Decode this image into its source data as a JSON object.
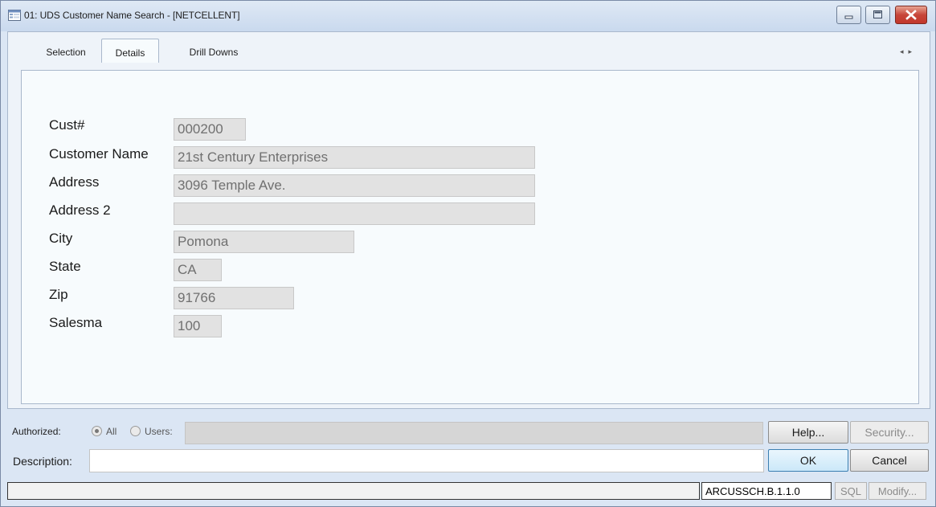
{
  "window": {
    "title": "01:  UDS Customer Name Search - [NETCELLENT]",
    "controls": {
      "minimize": "minimize-icon",
      "maximize": "maximize-icon",
      "close": "close-icon"
    }
  },
  "tabs": [
    {
      "label": "Selection",
      "active": false
    },
    {
      "label": "Details",
      "active": true
    },
    {
      "label": "Drill Downs",
      "active": false
    }
  ],
  "tab_scroll": {
    "left": "◂",
    "right": "▸"
  },
  "details": {
    "fields": [
      {
        "label": "Cust#",
        "value": "000200"
      },
      {
        "label": "Customer Name",
        "value": "21st Century Enterprises"
      },
      {
        "label": "Address",
        "value": "3096 Temple Ave."
      },
      {
        "label": "Address 2",
        "value": ""
      },
      {
        "label": "City",
        "value": "Pomona"
      },
      {
        "label": "State",
        "value": "CA"
      },
      {
        "label": "Zip",
        "value": "91766"
      },
      {
        "label": "Salesma",
        "value": "100"
      }
    ]
  },
  "authorization": {
    "label": "Authorized:",
    "option_all": "All",
    "option_users": "Users:",
    "selected": "All",
    "users_value": ""
  },
  "description": {
    "label": "Description:",
    "value": ""
  },
  "buttons": {
    "help": "Help...",
    "security": "Security...",
    "ok": "OK",
    "cancel": "Cancel"
  },
  "statusbar": {
    "message": "",
    "program_code": "ARCUSSCH.B.1.1.0",
    "sql": "SQL",
    "modify": "Modify..."
  },
  "colors": {
    "window_frame": "#dbe6f4",
    "panel_bg": "#f7fbfd",
    "readonly_field": "#e2e2e2",
    "close_button": "#c7463a"
  }
}
